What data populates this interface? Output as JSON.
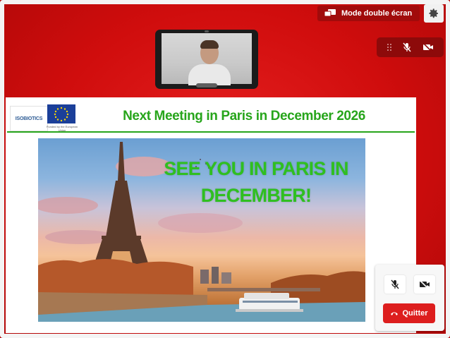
{
  "toolbar": {
    "dual_screen_label": "Mode double écran",
    "dual_screen_icon": "dual-screen-icon",
    "settings_icon": "gear-icon"
  },
  "self_controls": {
    "drag_icon": "drag-handle-icon",
    "mic_icon": "mic-off-icon",
    "camera_icon": "camera-off-icon"
  },
  "video_tile": {
    "participant_icon": "participant-video"
  },
  "slide": {
    "logo_text": "ISOBIOTICS",
    "eu_caption": "Funded by the European Union",
    "title": "Next Meeting in Paris in December 2026",
    "overlay_line1": "SEE YOU IN PARIS IN",
    "overlay_line2": "DECEMBER!"
  },
  "call_controls": {
    "mic_icon": "mic-off-icon",
    "camera_icon": "camera-off-icon",
    "quit_label": "Quitter",
    "quit_icon": "hang-up-icon"
  },
  "colors": {
    "background_red": "#d00d0d",
    "title_green": "#27a51b",
    "quit_red": "#dd1e1e"
  }
}
